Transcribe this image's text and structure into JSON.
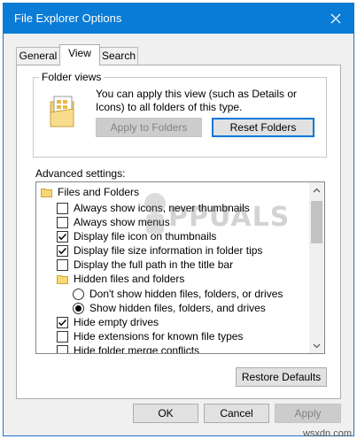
{
  "window": {
    "title": "File Explorer Options",
    "accent": "#0a7bd6"
  },
  "tabs": [
    {
      "label": "General",
      "active": false
    },
    {
      "label": "View",
      "active": true
    },
    {
      "label": "Search",
      "active": false
    }
  ],
  "folder_views": {
    "legend": "Folder views",
    "description": "You can apply this view (such as Details or Icons) to all folders of this type.",
    "apply_label": "Apply to Folders",
    "reset_label": "Reset Folders"
  },
  "advanced": {
    "label": "Advanced settings:",
    "items": [
      {
        "kind": "folder",
        "label": "Files and Folders",
        "level": 0
      },
      {
        "kind": "checkbox",
        "label": "Always show icons, never thumbnails",
        "checked": false,
        "level": 1
      },
      {
        "kind": "checkbox",
        "label": "Always show menus",
        "checked": false,
        "level": 1
      },
      {
        "kind": "checkbox",
        "label": "Display file icon on thumbnails",
        "checked": true,
        "level": 1
      },
      {
        "kind": "checkbox",
        "label": "Display file size information in folder tips",
        "checked": true,
        "level": 1
      },
      {
        "kind": "checkbox",
        "label": "Display the full path in the title bar",
        "checked": false,
        "level": 1
      },
      {
        "kind": "folder",
        "label": "Hidden files and folders",
        "level": 1
      },
      {
        "kind": "radio",
        "label": "Don't show hidden files, folders, or drives",
        "checked": false,
        "level": 2
      },
      {
        "kind": "radio",
        "label": "Show hidden files, folders, and drives",
        "checked": true,
        "level": 2
      },
      {
        "kind": "checkbox",
        "label": "Hide empty drives",
        "checked": true,
        "level": 1
      },
      {
        "kind": "checkbox",
        "label": "Hide extensions for known file types",
        "checked": false,
        "level": 1
      },
      {
        "kind": "checkbox",
        "label": "Hide folder merge conflicts",
        "checked": false,
        "level": 1
      }
    ]
  },
  "restore_defaults_label": "Restore Defaults",
  "footer": {
    "ok_label": "OK",
    "cancel_label": "Cancel",
    "apply_label": "Apply"
  },
  "watermark": {
    "text": "PPUALS"
  },
  "site_credit": "wsxdn.com"
}
